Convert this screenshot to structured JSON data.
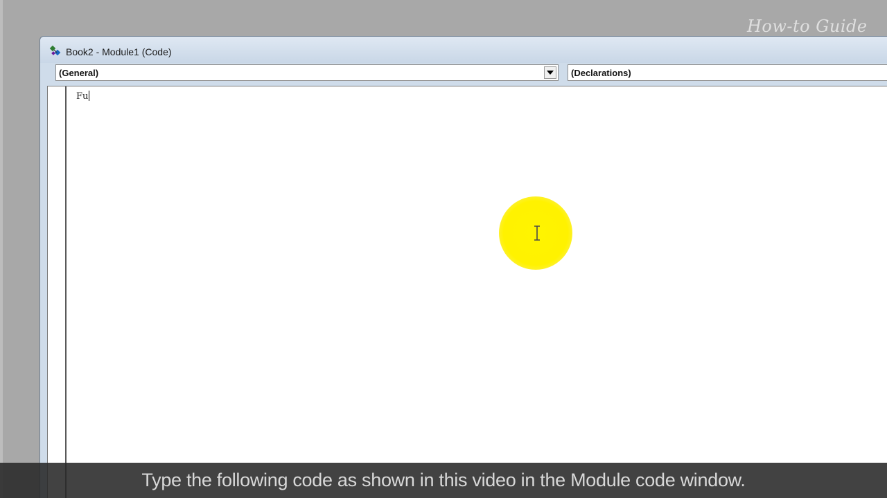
{
  "watermark": "How-to Guide",
  "window": {
    "title": "Book2 - Module1 (Code)",
    "icon": "vba-module-icon"
  },
  "object_combo": {
    "selected": "(General)"
  },
  "procedure_combo": {
    "selected": "(Declarations)"
  },
  "editor": {
    "code_line_1": "Fu"
  },
  "overlay": {
    "cursor_highlight_color": "#fff200",
    "cursor_icon": "i-beam-cursor-icon"
  },
  "caption": "Type the following code as shown in this video in the Module code window."
}
